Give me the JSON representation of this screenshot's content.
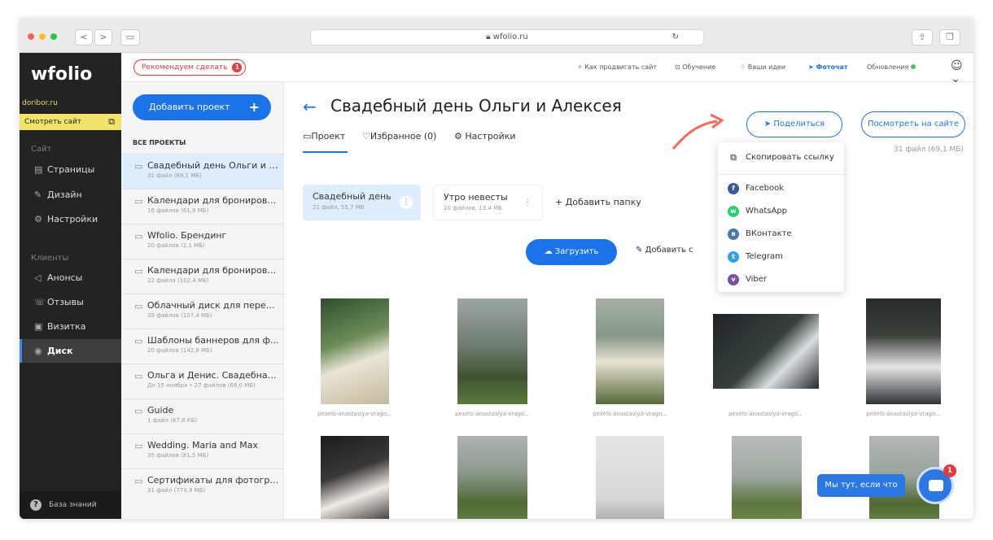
{
  "browser": {
    "url": "wfolio.ru",
    "back": "<",
    "fwd": ">"
  },
  "sidebar": {
    "logo": "wfolio",
    "domain": "doribor.ru",
    "see_site": "Смотреть сайт",
    "section_site": "Сайт",
    "items_site": [
      {
        "label": "Страницы",
        "icon": "▤"
      },
      {
        "label": "Дизайн",
        "icon": "✎"
      },
      {
        "label": "Настройки",
        "icon": "⚙"
      }
    ],
    "section_clients": "Клиенты",
    "items_clients": [
      {
        "label": "Анонсы",
        "icon": "◁"
      },
      {
        "label": "Отзывы",
        "icon": "☏"
      },
      {
        "label": "Визитка",
        "icon": "▣"
      },
      {
        "label": "Диск",
        "icon": "◉"
      }
    ],
    "kb": "База знаний"
  },
  "topbar": {
    "recommend": "Рекомендуем сделать",
    "badge": "1",
    "links": [
      "Как продвигать сайт",
      "Обучение",
      "Ваши идеи",
      "Фоточат",
      "Обновления"
    ]
  },
  "projects": {
    "add": "Добавить проект",
    "all": "ВСЕ ПРОЕКТЫ",
    "items": [
      {
        "name": "Свадебный день Ольги и А...",
        "meta": "31 файл (69,1 МБ)"
      },
      {
        "name": "Календари для бронирова...",
        "meta": "16 файлов (61,9 МБ)"
      },
      {
        "name": "Wfolio. Брендинг",
        "meta": "20 файлов (2,1 МБ)"
      },
      {
        "name": "Календари для бронирова...",
        "meta": "22 файла (102,4 МБ)"
      },
      {
        "name": "Облачный диск для перед...",
        "meta": "39 файлов (107,4 МБ)"
      },
      {
        "name": "Шаблоны баннеров для ф...",
        "meta": "20 файлов (142,8 МБ)"
      },
      {
        "name": "Ольга и Денис. Свадебная ...",
        "meta": "До 15 ноября • 27 файлов (68,0 МБ)"
      },
      {
        "name": "Guide",
        "meta": "1 файл (67,8 КБ)"
      },
      {
        "name": "Wedding. Maria and Max",
        "meta": "35 файлов (81,5 МБ)"
      },
      {
        "name": "Сертификаты для фотогра...",
        "meta": "31 файл (774,8 МБ)"
      }
    ]
  },
  "main": {
    "back": "←",
    "title": "Свадебный день Ольги и Алексея",
    "tabs": [
      "Проект",
      "Избранное (0)",
      "Настройки"
    ],
    "share": "Поделиться",
    "view": "Посмотреть на сайте",
    "count": "31 файл (69,1 МБ)",
    "folders": [
      {
        "name": "Свадебный день",
        "meta": "21 файл, 55,7 МБ"
      },
      {
        "name": "Утро невесты",
        "meta": "10 файлов, 13,4 МБ"
      }
    ],
    "add_folder": "+ Добавить папку",
    "upload": "Загрузить",
    "add_cover": "Добавить с",
    "caption": "pexels-anastasiya-vrago..."
  },
  "share_menu": {
    "copy": "Скопировать ссылку",
    "items": [
      {
        "label": "Facebook",
        "color": "#3b5998",
        "glyph": "f"
      },
      {
        "label": "WhatsApp",
        "color": "#25d366",
        "glyph": "w"
      },
      {
        "label": "ВКонтакте",
        "color": "#4a76a8",
        "glyph": "в"
      },
      {
        "label": "Telegram",
        "color": "#2ca5e0",
        "glyph": "t"
      },
      {
        "label": "Viber",
        "color": "#7b519d",
        "glyph": "v"
      }
    ]
  },
  "chat": {
    "text": "Мы тут, если что",
    "badge": "1"
  }
}
